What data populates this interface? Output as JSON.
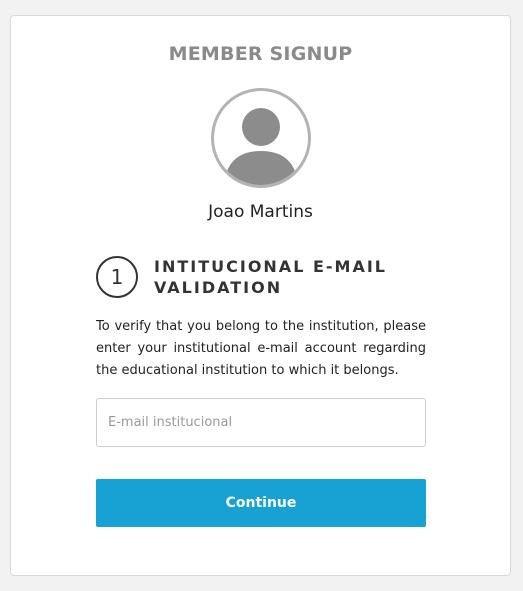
{
  "header": {
    "title": "MEMBER SIGNUP"
  },
  "profile": {
    "avatar_icon": "user-silhouette-icon",
    "name": "Joao Martins"
  },
  "step": {
    "number": "1",
    "title": "INTITUCIONAL E-MAIL VALIDATION",
    "description": "To verify that you belong to the institution, please enter your institutional e-mail account regarding the educational institution to which it belongs."
  },
  "form": {
    "email_placeholder": "E-mail institucional",
    "email_value": "",
    "continue_label": "Continue"
  },
  "colors": {
    "accent": "#17a2d3",
    "title_gray": "#8a8a8a",
    "avatar_gray": "#8c8c8c"
  }
}
